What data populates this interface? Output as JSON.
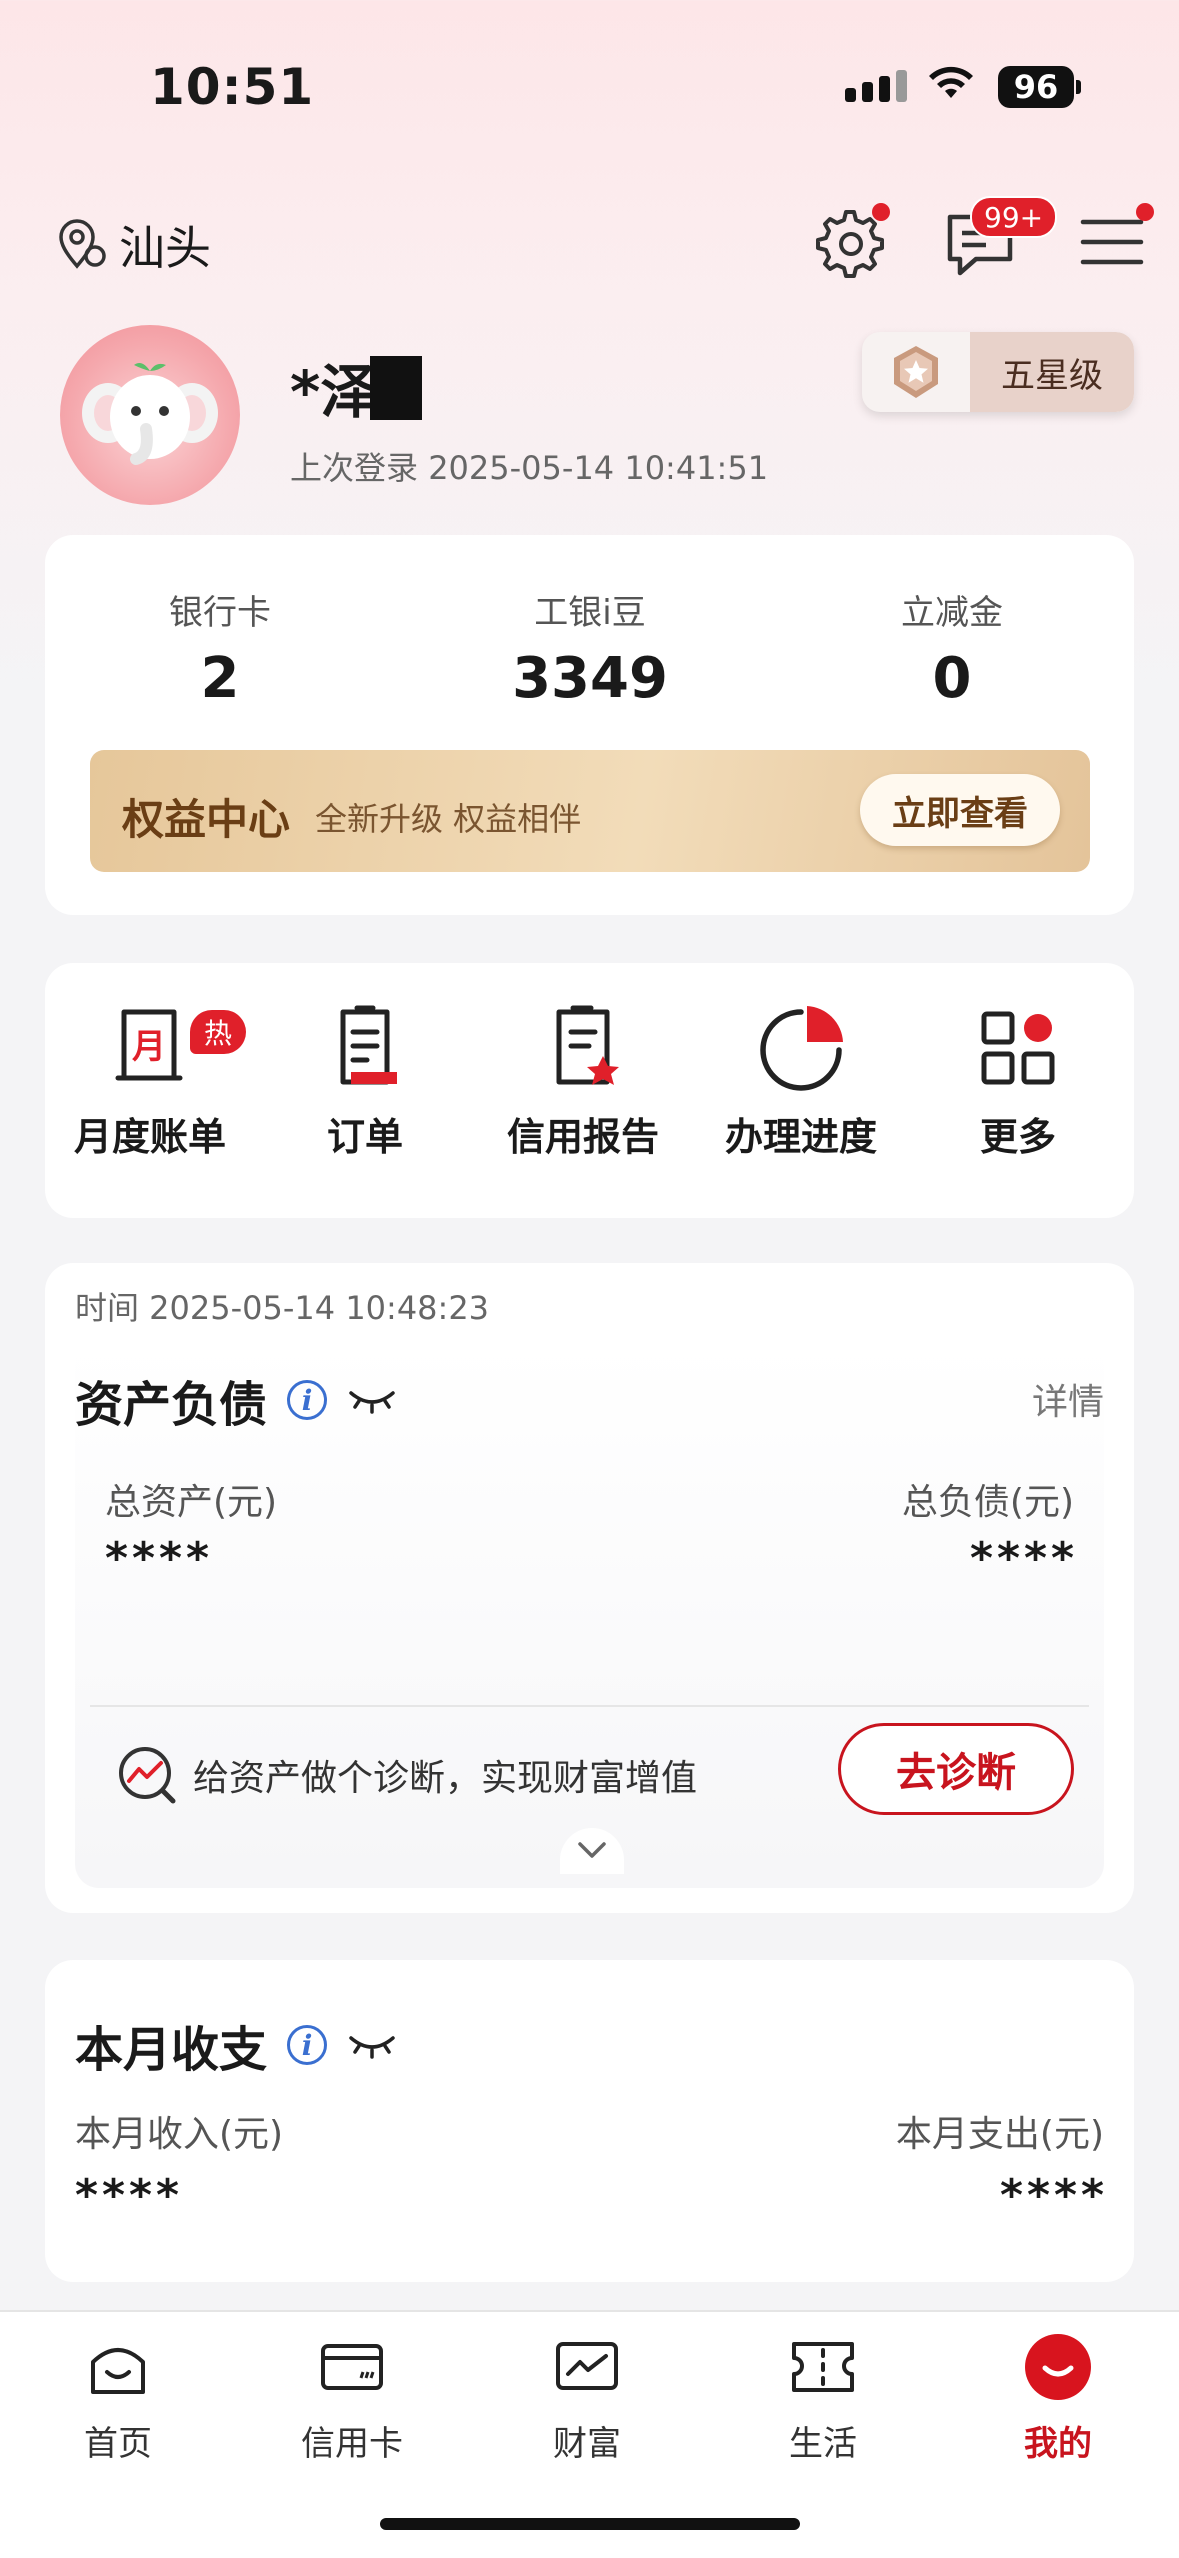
{
  "status_bar": {
    "time": "10:51",
    "battery": "96"
  },
  "header": {
    "location": "汕头",
    "message_badge": "99+"
  },
  "profile": {
    "name": "*泽",
    "last_login_label": "上次登录",
    "last_login_time": "2025-05-14 10:41:51",
    "level": "五星级"
  },
  "stats": [
    {
      "label": "银行卡",
      "value": "2"
    },
    {
      "label": "工银i豆",
      "value": "3349"
    },
    {
      "label": "立减金",
      "value": "0"
    }
  ],
  "benefit": {
    "title": "权益中心",
    "subtitle": "全新升级 权益相伴",
    "button": "立即查看"
  },
  "quick_actions": [
    {
      "label": "月度账单",
      "badge": "热",
      "icon": "monthly-bill-icon",
      "icon_text": "月"
    },
    {
      "label": "订单",
      "icon": "order-icon"
    },
    {
      "label": "信用报告",
      "icon": "credit-report-icon"
    },
    {
      "label": "办理进度",
      "icon": "progress-icon"
    },
    {
      "label": "更多",
      "icon": "more-icon"
    }
  ],
  "assets": {
    "time_label": "时间 2025-05-14 10:48:23",
    "title": "资产负债",
    "detail": "详情",
    "total_assets_label": "总资产(元)",
    "total_assets_value": "****",
    "total_liabilities_label": "总负债(元)",
    "total_liabilities_value": "****",
    "diagnosis_text": "给资产做个诊断，实现财富增值",
    "diagnosis_button": "去诊断"
  },
  "monthly": {
    "title": "本月收支",
    "income_label": "本月收入(元)",
    "income_value": "****",
    "expense_label": "本月支出(元)",
    "expense_value": "****"
  },
  "tabs": [
    {
      "label": "首页",
      "icon": "home-icon"
    },
    {
      "label": "信用卡",
      "icon": "credit-card-icon"
    },
    {
      "label": "财富",
      "icon": "wealth-icon"
    },
    {
      "label": "生活",
      "icon": "life-ticket-icon"
    },
    {
      "label": "我的",
      "icon": "mine-icon",
      "active": true
    }
  ],
  "colors": {
    "brand_red": "#c8141e",
    "badge_red": "#e0202a",
    "gold": "#e6c79a"
  }
}
